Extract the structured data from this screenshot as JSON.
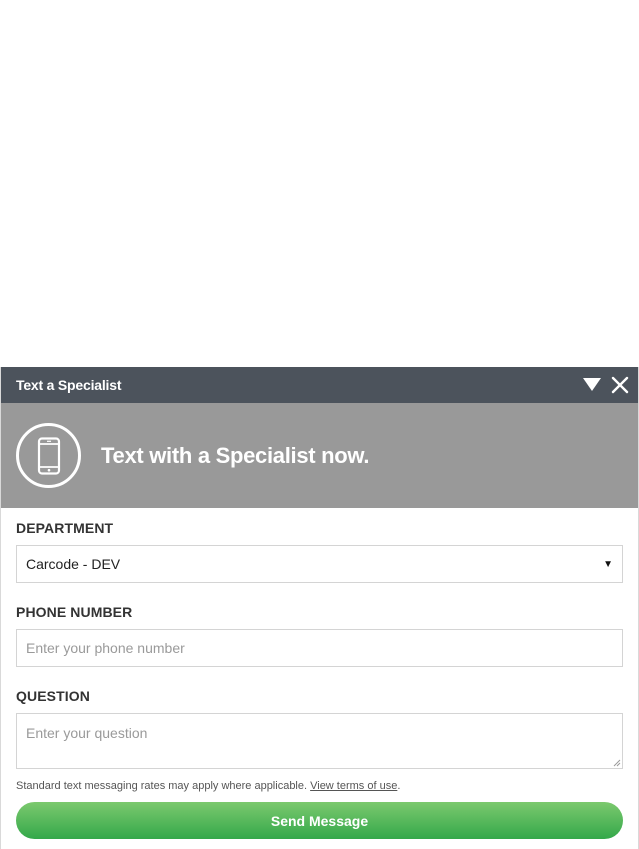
{
  "widget": {
    "title": "Text a Specialist",
    "minimize_icon": "triangle-down-icon",
    "close_icon": "close-icon"
  },
  "banner": {
    "icon": "mobile-phone-icon",
    "headline": "Text with a Specialist now."
  },
  "form": {
    "department": {
      "label": "DEPARTMENT",
      "selected": "Carcode - DEV"
    },
    "phone": {
      "label": "PHONE NUMBER",
      "placeholder": "Enter your phone number"
    },
    "question": {
      "label": "QUESTION",
      "placeholder": "Enter your question"
    },
    "disclaimer": {
      "text": "Standard text messaging rates may apply where applicable.",
      "link": "View terms of use",
      "suffix": "."
    },
    "send_label": "Send Message"
  },
  "colors": {
    "titlebar": "#4c535c",
    "banner": "#999999",
    "button_top": "#7cc96e",
    "button_bottom": "#33a84a"
  }
}
